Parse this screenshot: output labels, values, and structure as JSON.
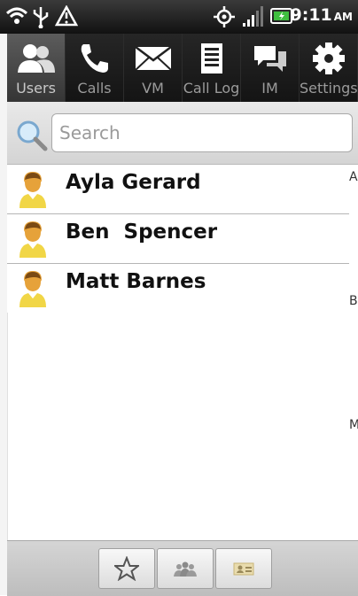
{
  "status": {
    "time": "9:11",
    "ampm": "AM",
    "icons": [
      "wifi-icon",
      "usb-icon",
      "warning-icon",
      "gps-icon",
      "signal-icon",
      "battery-icon"
    ]
  },
  "tabs": [
    {
      "label": "Users",
      "icon": "users-icon",
      "active": true
    },
    {
      "label": "Calls",
      "icon": "phone-icon",
      "active": false
    },
    {
      "label": "VM",
      "icon": "envelope-icon",
      "active": false
    },
    {
      "label": "Call Log",
      "icon": "document-icon",
      "active": false
    },
    {
      "label": "IM",
      "icon": "chat-icon",
      "active": false
    },
    {
      "label": "Settings",
      "icon": "gear-icon",
      "active": false
    }
  ],
  "search": {
    "placeholder": "Search"
  },
  "contacts": [
    {
      "name": "Ayla Gerard"
    },
    {
      "name": "Ben  Spencer"
    },
    {
      "name": "Matt Barnes"
    }
  ],
  "index_letters": [
    "A",
    "B",
    "M"
  ],
  "bottom_buttons": [
    {
      "icon": "star-icon"
    },
    {
      "icon": "group-icon"
    },
    {
      "icon": "contact-card-icon"
    }
  ],
  "colors": {
    "avatar_skin": "#e8a33a",
    "avatar_shirt": "#f2d74a",
    "tab_active": "#4a4a4a"
  }
}
